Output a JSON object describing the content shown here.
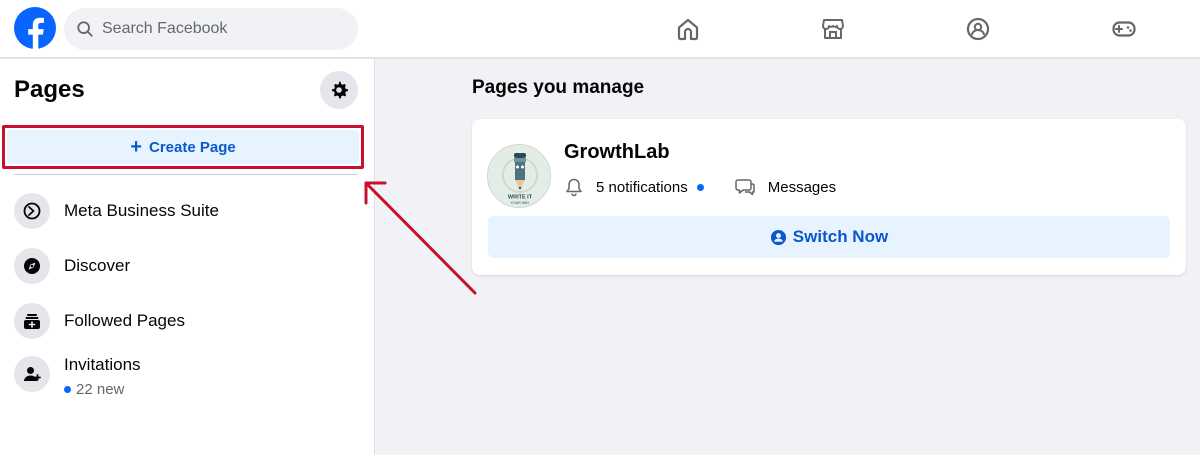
{
  "topbar": {
    "search_placeholder": "Search Facebook",
    "nav_icons": [
      "home-icon",
      "marketplace-icon",
      "groups-icon",
      "gaming-icon"
    ]
  },
  "sidebar": {
    "title": "Pages",
    "create_label": "Create Page",
    "items": [
      {
        "label": "Meta Business Suite",
        "icon": "meta-business-icon"
      },
      {
        "label": "Discover",
        "icon": "compass-icon"
      },
      {
        "label": "Followed Pages",
        "icon": "followed-pages-icon"
      },
      {
        "label": "Invitations",
        "icon": "add-person-icon",
        "sub": "22 new"
      }
    ]
  },
  "main": {
    "title": "Pages you manage",
    "page": {
      "name": "GrowthLab",
      "notifications": "5 notifications",
      "messages": "Messages",
      "switch_label": "Switch Now",
      "avatar_text": "WRITE IT",
      "avatar_subtext": "YOUR WAY"
    }
  },
  "colors": {
    "brand": "#0866ff",
    "accent_text": "#0a58ca",
    "highlight": "#c8102e",
    "button_bg": "#e7f3ff"
  }
}
